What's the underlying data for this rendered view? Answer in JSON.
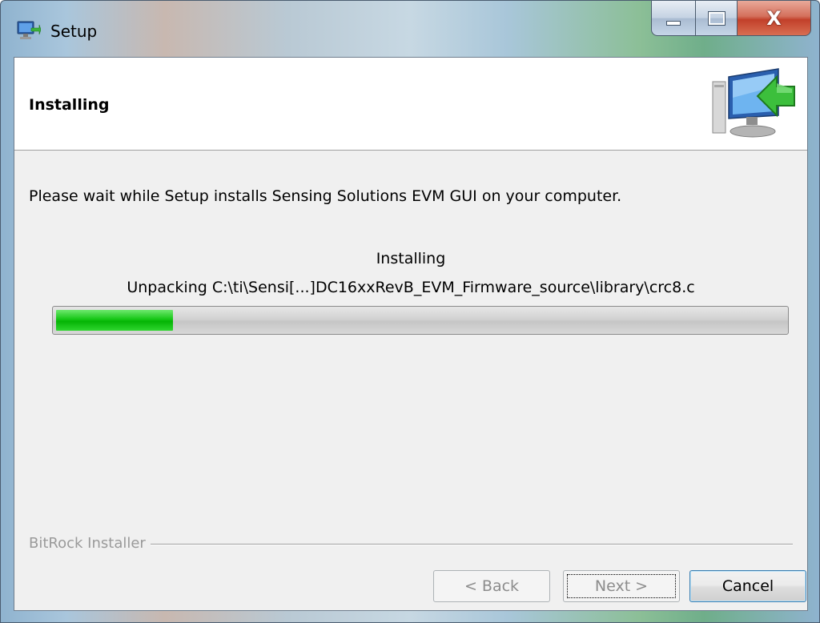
{
  "window": {
    "title": "Setup",
    "controls": {
      "close_glyph": "X"
    }
  },
  "header": {
    "title": "Installing",
    "icon": "computer-install-icon"
  },
  "content": {
    "description": "Please wait while Setup installs Sensing Solutions EVM GUI on your computer.",
    "status_line": "Installing",
    "detail_line": "Unpacking C:\\ti\\Sensi[...]DC16xxRevB_EVM_Firmware_source\\library\\crc8.c",
    "progress_percent": 16
  },
  "footer": {
    "brand_label": "BitRock Installer",
    "back_label": "< Back",
    "next_label": "Next >",
    "cancel_label": "Cancel"
  },
  "colors": {
    "progress_fill": "#05b405",
    "close_button": "#c2402a"
  }
}
